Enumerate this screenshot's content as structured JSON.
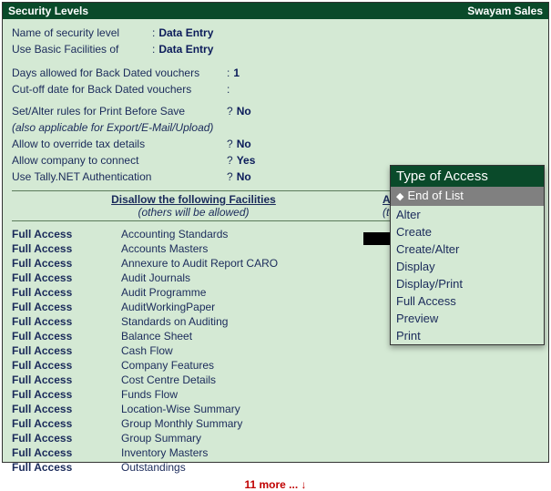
{
  "titlebar": {
    "left": "Security Levels",
    "right": "Swayam Sales"
  },
  "fields": {
    "name_label": "Name of security level",
    "name_value": "Data Entry",
    "basic_label": "Use Basic Facilities of",
    "basic_value": "Data Entry",
    "days_label": "Days allowed for Back Dated vouchers",
    "days_value": "1",
    "cutoff_label": "Cut-off date for Back Dated vouchers",
    "cutoff_value": "",
    "print_label": "Set/Alter rules for Print Before Save",
    "print_value": "No",
    "print_note": "(also applicable for Export/E-Mail/Upload)",
    "tax_label": "Allow to override tax details",
    "tax_value": "No",
    "connect_label": "Allow company to connect",
    "connect_value": "Yes",
    "tallynet_label": "Use Tally.NET Authentication",
    "tallynet_value": "No"
  },
  "columns": {
    "left_head": "Disallow the following Facilities",
    "left_sub": "(others will be allowed)",
    "right_head": "Allow the f",
    "right_sub": "(to re-enable"
  },
  "facilities": [
    {
      "access": "Full Access",
      "name": "Accounting Standards"
    },
    {
      "access": "Full Access",
      "name": "Accounts Masters"
    },
    {
      "access": "Full Access",
      "name": "Annexure to Audit Report CARO"
    },
    {
      "access": "Full Access",
      "name": "Audit Journals"
    },
    {
      "access": "Full Access",
      "name": "Audit Programme"
    },
    {
      "access": "Full Access",
      "name": "AuditWorkingPaper"
    },
    {
      "access": "Full Access",
      "name": "Standards on Auditing"
    },
    {
      "access": "Full Access",
      "name": "Balance Sheet"
    },
    {
      "access": "Full Access",
      "name": "Cash Flow"
    },
    {
      "access": "Full Access",
      "name": "Company Features"
    },
    {
      "access": "Full Access",
      "name": "Cost Centre Details"
    },
    {
      "access": "Full Access",
      "name": "Funds Flow"
    },
    {
      "access": "Full Access",
      "name": "Location-Wise Summary"
    },
    {
      "access": "Full Access",
      "name": "Group Monthly Summary"
    },
    {
      "access": "Full Access",
      "name": "Group Summary"
    },
    {
      "access": "Full Access",
      "name": "Inventory Masters"
    },
    {
      "access": "Full Access",
      "name": "Outstandings"
    }
  ],
  "more_text": "11 more ... ↓",
  "popup": {
    "title": "Type of Access",
    "items": [
      "End of List",
      "Alter",
      "Create",
      "Create/Alter",
      "Display",
      "Display/Print",
      "Full Access",
      "Preview",
      "Print"
    ],
    "selected_index": 0
  }
}
